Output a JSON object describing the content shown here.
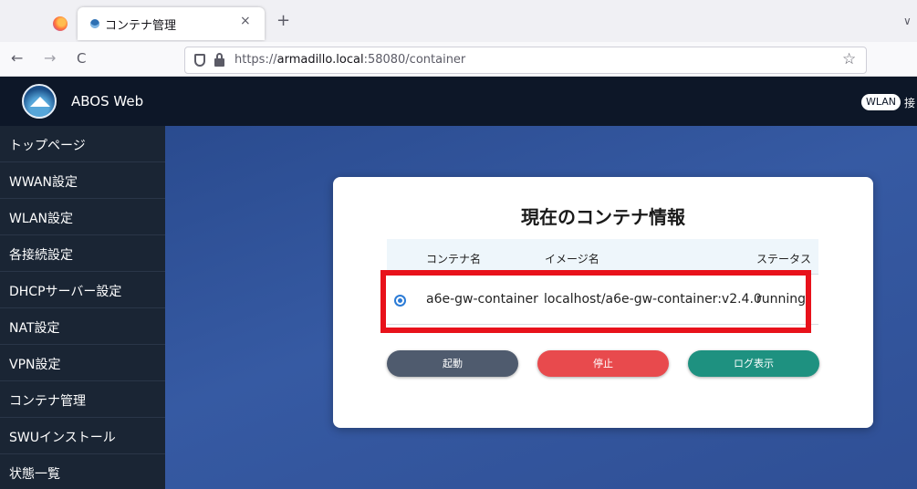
{
  "browser": {
    "tab_title": "コンテナ管理",
    "tab_close": "×",
    "new_tab": "+",
    "tab_list": "∨",
    "back": "←",
    "forward": "→",
    "reload": "C",
    "url_prefix": "https://",
    "url_host": "armadillo.local",
    "url_path": ":58080/container",
    "bookmark_star": "☆"
  },
  "header": {
    "app_name": "ABOS Web",
    "wlan_badge": "WLAN",
    "connection_text": "接"
  },
  "sidebar": {
    "items": [
      {
        "label": "トップページ"
      },
      {
        "label": "WWAN設定"
      },
      {
        "label": "WLAN設定"
      },
      {
        "label": "各接続設定"
      },
      {
        "label": "DHCPサーバー設定"
      },
      {
        "label": "NAT設定"
      },
      {
        "label": "VPN設定"
      },
      {
        "label": "コンテナ管理"
      },
      {
        "label": "SWUインストール"
      },
      {
        "label": "状態一覧"
      }
    ]
  },
  "main": {
    "card_title": "現在のコンテナ情報",
    "columns": [
      "コンテナ名",
      "イメージ名",
      "ステータス"
    ],
    "rows": [
      {
        "selected": true,
        "container": "a6e-gw-container",
        "image": "localhost/a6e-gw-container:v2.4.0",
        "status": "running"
      }
    ],
    "buttons": {
      "start": "起動",
      "stop": "停止",
      "log": "ログ表示"
    }
  },
  "colors": {
    "header_bg": "#0d1728",
    "sidebar_bg": "#1a2534",
    "start_button": "#4f5b6e",
    "stop_button": "#e84a4d",
    "log_button": "#1e9180",
    "highlight_box": "#e8121b"
  }
}
